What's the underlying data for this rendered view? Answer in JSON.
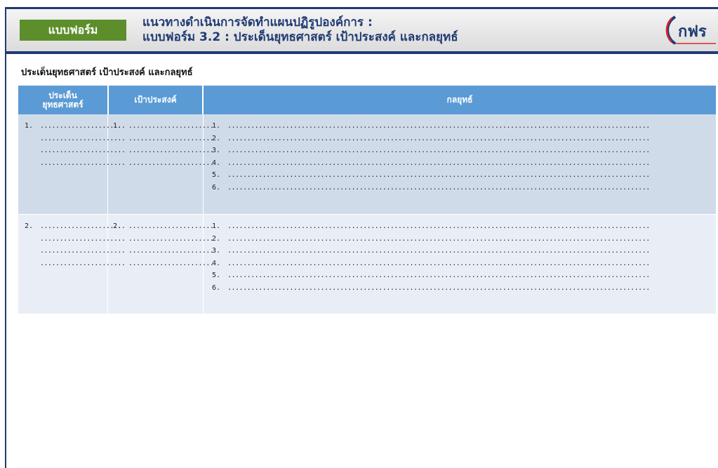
{
  "header": {
    "badge": "แบบฟอร์ม",
    "title_line1": "แนวทางดำเนินการจัดทำแผนปฏิรูปองค์การ :",
    "title_line2": "แบบฟอร์ม 3.2 : ประเด็นยุทธศาสตร์ เป้าประสงค์ และกลยุทธ์",
    "logo_text": "กฟร"
  },
  "section_title": "ประเด็นยุทธศาสตร์ เป้าประสงค์ และกลยุทธ์",
  "table": {
    "headers": {
      "issue_line1": "ประเด็น",
      "issue_line2": "ยุทธศาสตร์",
      "goal": "เป้าประสงค์",
      "strategy": "กลยุทธ์"
    },
    "rows": [
      {
        "issue_num": "1.",
        "goal_num": "1.",
        "placeholder_short": "......................",
        "strategy_nums": [
          "1.",
          "2.",
          "3.",
          "4.",
          "5.",
          "6."
        ],
        "placeholder_long": "............................................................................................................."
      },
      {
        "issue_num": "2.",
        "goal_num": "2.",
        "placeholder_short": "......................",
        "strategy_nums": [
          "1.",
          "2.",
          "3.",
          "4.",
          "5.",
          "6."
        ],
        "placeholder_long": "............................................................................................................."
      }
    ]
  },
  "colors": {
    "brand_navy": "#1f3b73",
    "badge_green": "#5c8f2b",
    "header_blue": "#5b9bd5",
    "row_odd": "#d0dbea",
    "row_even": "#e9eef6"
  }
}
